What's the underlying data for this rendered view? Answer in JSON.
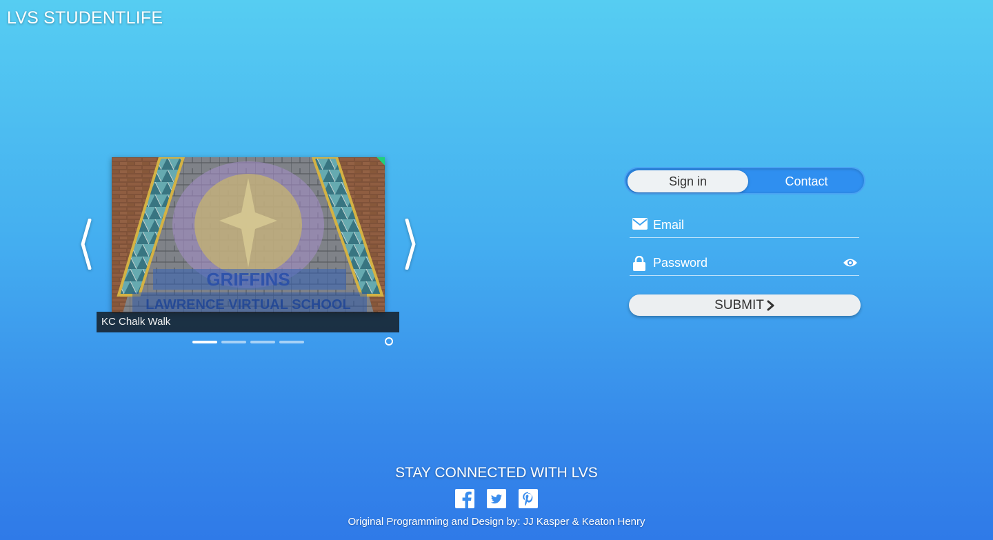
{
  "brand": {
    "title": "LVS STUDENTLIFE"
  },
  "carousel": {
    "caption": "KC Chalk Walk",
    "slide_count": 4,
    "active_index": 0,
    "prev_icon": "chevron-left-icon",
    "next_icon": "chevron-right-icon"
  },
  "login": {
    "tabs": [
      {
        "label": "Sign in",
        "active": true
      },
      {
        "label": "Contact",
        "active": false
      }
    ],
    "email": {
      "placeholder": "Email",
      "value": "",
      "icon": "envelope-icon"
    },
    "password": {
      "placeholder": "Password",
      "value": "",
      "icon": "lock-icon",
      "toggle_icon": "eye-icon"
    },
    "submit_label": "SUBMIT"
  },
  "footer": {
    "title": "STAY CONNECTED WITH LVS",
    "socials": [
      "facebook-icon",
      "twitter-icon",
      "pinterest-icon"
    ],
    "credit": "Original Programming and Design by: JJ Kasper & Keaton Henry"
  },
  "colors": {
    "gradient_top": "#56cdf2",
    "gradient_bottom": "#2f7ae8",
    "pill": "#eef2f4",
    "caption_bg": "#14181e"
  }
}
